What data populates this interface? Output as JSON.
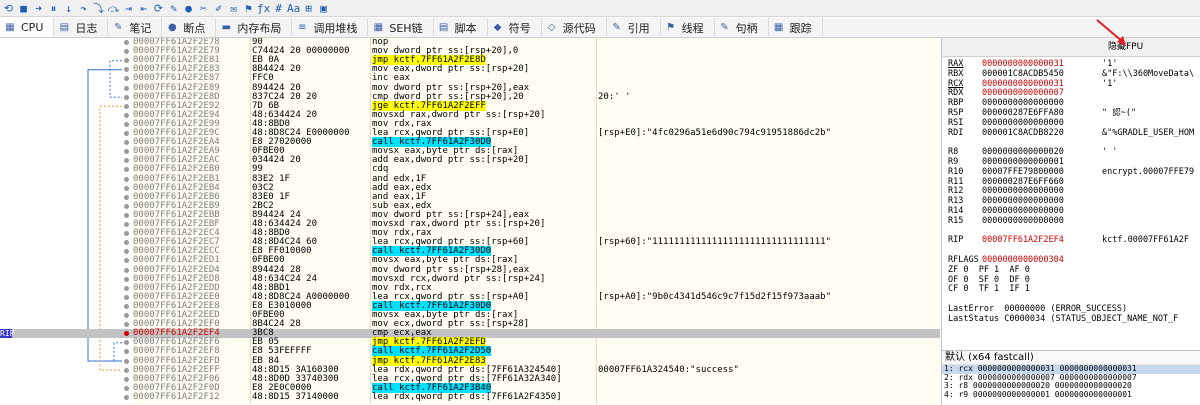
{
  "toolbar": {
    "icons": [
      "restart-icon",
      "stop-icon",
      "run-icon",
      "pause-icon",
      "step-into-icon",
      "step-over-icon",
      "trace-into-icon",
      "trace-over-icon",
      "execute-till-return-icon",
      "run-to-user-code-icon",
      "animate-icon",
      "patch-icon",
      "breakpoint-icon",
      "script-icon",
      "comment-icon",
      "label-icon",
      "bookmark-icon",
      "function-icon",
      "hash-icon",
      "font-icon",
      "calculator-icon",
      "scylla-icon"
    ],
    "glyphs": [
      "⟲",
      "■",
      "➜",
      "⏸",
      "↓",
      "↷",
      "⤵",
      "⤼",
      "⇥",
      "⇤",
      "⟳",
      "✎",
      "●",
      "✂",
      "✐",
      "✉",
      "⚑",
      "ƒx",
      "#",
      "Aa",
      "⊞",
      "▣"
    ]
  },
  "tabs": [
    {
      "label": "CPU",
      "icon": "cpu-icon",
      "glyph": "▦"
    },
    {
      "label": "日志",
      "icon": "log-icon",
      "glyph": "▤"
    },
    {
      "label": "笔记",
      "icon": "notes-icon",
      "glyph": "✎"
    },
    {
      "label": "断点",
      "icon": "breakpoint-icon",
      "glyph": "●"
    },
    {
      "label": "内存布局",
      "icon": "memory-map-icon",
      "glyph": "▬"
    },
    {
      "label": "调用堆栈",
      "icon": "call-stack-icon",
      "glyph": "≡"
    },
    {
      "label": "SEH链",
      "icon": "seh-icon",
      "glyph": "▦"
    },
    {
      "label": "脚本",
      "icon": "script-icon",
      "glyph": "▤"
    },
    {
      "label": "符号",
      "icon": "symbols-icon",
      "glyph": "◆"
    },
    {
      "label": "源代码",
      "icon": "source-icon",
      "glyph": "◇"
    },
    {
      "label": "引用",
      "icon": "references-icon",
      "glyph": "✎"
    },
    {
      "label": "线程",
      "icon": "threads-icon",
      "glyph": "⚑"
    },
    {
      "label": "句柄",
      "icon": "handles-icon",
      "glyph": "✎"
    },
    {
      "label": "跟踪",
      "icon": "trace-icon",
      "glyph": "▦"
    }
  ],
  "disasm": [
    {
      "addr": "00007FF61A2F2E78",
      "bytes": "90",
      "instr": "nop",
      "cmt": ""
    },
    {
      "addr": "00007FF61A2F2E79",
      "bytes": "C74424 20 00000000",
      "instr": "mov dword ptr ss:[rsp+20],0",
      "cmt": ""
    },
    {
      "addr": "00007FF61A2F2E81",
      "bytes": "EB 0A",
      "instr": "jmp kctf.7FF61A2F2E8D",
      "cmt": "",
      "hl": "jmp"
    },
    {
      "addr": "00007FF61A2F2E83",
      "bytes": "8B4424 20",
      "instr": "mov eax,dword ptr ss:[rsp+20]",
      "cmt": ""
    },
    {
      "addr": "00007FF61A2F2E87",
      "bytes": "FFC0",
      "instr": "inc eax",
      "cmt": ""
    },
    {
      "addr": "00007FF61A2F2E89",
      "bytes": "894424 20",
      "instr": "mov dword ptr ss:[rsp+20],eax",
      "cmt": ""
    },
    {
      "addr": "00007FF61A2F2E8D",
      "bytes": "837C24 20 20",
      "instr": "cmp dword ptr ss:[rsp+20],20",
      "cmt": "20:' '"
    },
    {
      "addr": "00007FF61A2F2E92",
      "bytes": "7D 6B",
      "instr": "jge kctf.7FF61A2F2EFF",
      "cmt": "",
      "hl": "jmp"
    },
    {
      "addr": "00007FF61A2F2E94",
      "bytes": "48:634424 20",
      "instr": "movsxd rax,dword ptr ss:[rsp+20]",
      "cmt": ""
    },
    {
      "addr": "00007FF61A2F2E99",
      "bytes": "48:8BD0",
      "instr": "mov rdx,rax",
      "cmt": ""
    },
    {
      "addr": "00007FF61A2F2E9C",
      "bytes": "48:8D8C24 E0000000",
      "instr": "lea rcx,qword ptr ss:[rsp+E0]",
      "cmt": "[rsp+E0]:\"4fc0296a51e6d90c794c91951886dc2b\""
    },
    {
      "addr": "00007FF61A2F2EA4",
      "bytes": "E8 27020000",
      "instr": "call kctf.7FF61A2F30D0",
      "cmt": "",
      "hl": "call"
    },
    {
      "addr": "00007FF61A2F2EA9",
      "bytes": "0FBE00",
      "instr": "movsx eax,byte ptr ds:[rax]",
      "cmt": ""
    },
    {
      "addr": "00007FF61A2F2EAC",
      "bytes": "034424 20",
      "instr": "add eax,dword ptr ss:[rsp+20]",
      "cmt": ""
    },
    {
      "addr": "00007FF61A2F2EB0",
      "bytes": "99",
      "instr": "cdq",
      "cmt": ""
    },
    {
      "addr": "00007FF61A2F2EB1",
      "bytes": "83E2 1F",
      "instr": "and edx,1F",
      "cmt": ""
    },
    {
      "addr": "00007FF61A2F2EB4",
      "bytes": "03C2",
      "instr": "add eax,edx",
      "cmt": ""
    },
    {
      "addr": "00007FF61A2F2EB6",
      "bytes": "83E0 1F",
      "instr": "and eax,1F",
      "cmt": ""
    },
    {
      "addr": "00007FF61A2F2EB9",
      "bytes": "2BC2",
      "instr": "sub eax,edx",
      "cmt": ""
    },
    {
      "addr": "00007FF61A2F2EBB",
      "bytes": "894424 24",
      "instr": "mov dword ptr ss:[rsp+24],eax",
      "cmt": ""
    },
    {
      "addr": "00007FF61A2F2EBF",
      "bytes": "48:634424 20",
      "instr": "movsxd rax,dword ptr ss:[rsp+20]",
      "cmt": ""
    },
    {
      "addr": "00007FF61A2F2EC4",
      "bytes": "48:8BD0",
      "instr": "mov rdx,rax",
      "cmt": ""
    },
    {
      "addr": "00007FF61A2F2EC7",
      "bytes": "48:8D4C24 60",
      "instr": "lea rcx,qword ptr ss:[rsp+60]",
      "cmt": "[rsp+60]:\"11111111111111111111111111111111\""
    },
    {
      "addr": "00007FF61A2F2ECC",
      "bytes": "E8 FF010000",
      "instr": "call kctf.7FF61A2F30D0",
      "cmt": "",
      "hl": "call"
    },
    {
      "addr": "00007FF61A2F2ED1",
      "bytes": "0FBE00",
      "instr": "movsx eax,byte ptr ds:[rax]",
      "cmt": ""
    },
    {
      "addr": "00007FF61A2F2ED4",
      "bytes": "894424 28",
      "instr": "mov dword ptr ss:[rsp+28],eax",
      "cmt": ""
    },
    {
      "addr": "00007FF61A2F2ED8",
      "bytes": "48:634C24 24",
      "instr": "movsxd rcx,dword ptr ss:[rsp+24]",
      "cmt": ""
    },
    {
      "addr": "00007FF61A2F2EDD",
      "bytes": "48:8BD1",
      "instr": "mov rdx,rcx",
      "cmt": ""
    },
    {
      "addr": "00007FF61A2F2EE0",
      "bytes": "48:8D8C24 A0000000",
      "instr": "lea rcx,qword ptr ss:[rsp+A0]",
      "cmt": "[rsp+A0]:\"9b0c4341d546c9c7f15d2f15f973aaab\""
    },
    {
      "addr": "00007FF61A2F2EE8",
      "bytes": "E8 E3010000",
      "instr": "call kctf.7FF61A2F30D0",
      "cmt": "",
      "hl": "call"
    },
    {
      "addr": "00007FF61A2F2EED",
      "bytes": "0FBE00",
      "instr": "movsx eax,byte ptr ds:[rax]",
      "cmt": ""
    },
    {
      "addr": "00007FF61A2F2EF0",
      "bytes": "8B4C24 28",
      "instr": "mov ecx,dword ptr ss:[rsp+28]",
      "cmt": ""
    },
    {
      "addr": "00007FF61A2F2EF4",
      "bytes": "3BC8",
      "instr": "cmp ecx,eax",
      "cmt": "",
      "ip": true
    },
    {
      "addr": "00007FF61A2F2EF6",
      "bytes": "EB 05",
      "instr": "jmp kctf.7FF61A2F2EFD",
      "cmt": "",
      "hl": "jmp"
    },
    {
      "addr": "00007FF61A2F2EF8",
      "bytes": "E8 53FEFFFF",
      "instr": "call kctf.7FF61A2F2D50",
      "cmt": "",
      "hl": "call"
    },
    {
      "addr": "00007FF61A2F2EFD",
      "bytes": "EB 84",
      "instr": "jmp kctf.7FF61A2F2E83",
      "cmt": "",
      "hl": "jmp"
    },
    {
      "addr": "00007FF61A2F2EFF",
      "bytes": "48:8D15 3A160300",
      "instr": "lea rdx,qword ptr ds:[7FF61A324540]",
      "cmt": "00007FF61A324540:\"success\""
    },
    {
      "addr": "00007FF61A2F2F06",
      "bytes": "48:8D0D 33740300",
      "instr": "lea rcx,qword ptr ds:[7FF61A32A340]",
      "cmt": ""
    },
    {
      "addr": "00007FF61A2F2F0D",
      "bytes": "E8 2E0C0000",
      "instr": "call kctf.7FF61A2F3B40",
      "cmt": "",
      "hl": "call"
    },
    {
      "addr": "00007FF61A2F2F12",
      "bytes": "48:8D15 37140000",
      "instr": "lea rdx,qword ptr ds:[7FF61A2F4350]",
      "cmt": ""
    }
  ],
  "ip_label": "RIP",
  "regs": {
    "header": "隐藏FPU",
    "rows": [
      {
        "n": "RAX",
        "v": "0000000000000031",
        "c": "'1'",
        "chg": true,
        "ul": true
      },
      {
        "n": "RBX",
        "v": "000001C8ACDB5450",
        "c": "&\"F:\\\\360MoveData\\"
      },
      {
        "n": "RCX",
        "v": "0000000000000031",
        "c": "'1'",
        "chg": true,
        "ul": true
      },
      {
        "n": "RDX",
        "v": "0000000000000007",
        "c": "",
        "chg": true
      },
      {
        "n": "RBP",
        "v": "0000000000000000",
        "c": ""
      },
      {
        "n": "RSP",
        "v": "000000287E6FFA80",
        "c": "\" 認~(\""
      },
      {
        "n": "RSI",
        "v": "0000000000000000",
        "c": ""
      },
      {
        "n": "RDI",
        "v": "000001C8ACDB8220",
        "c": "&\"%GRADLE_USER_HOM"
      },
      {
        "n": "",
        "v": "",
        "c": ""
      },
      {
        "n": "R8",
        "v": "0000000000000020",
        "c": "' '"
      },
      {
        "n": "R9",
        "v": "0000000000000001",
        "c": ""
      },
      {
        "n": "R10",
        "v": "00007FFE79800000",
        "c": "encrypt.00007FFE79"
      },
      {
        "n": "R11",
        "v": "000000287E6FF660",
        "c": ""
      },
      {
        "n": "R12",
        "v": "0000000000000000",
        "c": ""
      },
      {
        "n": "R13",
        "v": "0000000000000000",
        "c": ""
      },
      {
        "n": "R14",
        "v": "0000000000000000",
        "c": ""
      },
      {
        "n": "R15",
        "v": "0000000000000000",
        "c": ""
      },
      {
        "n": "",
        "v": "",
        "c": ""
      },
      {
        "n": "RIP",
        "v": "00007FF61A2F2EF4",
        "c": "kctf.00007FF61A2F",
        "chg": true
      },
      {
        "n": "",
        "v": "",
        "c": ""
      },
      {
        "n": "RFLAGS",
        "v": "0000000000000304",
        "c": "",
        "chg": true
      }
    ],
    "flags": [
      "ZF 0  PF 1  AF 0",
      "OF 0  SF 0  DF 0",
      "CF 0  TF 1  IF 1"
    ],
    "last_error": "LastError  00000000 (ERROR_SUCCESS)",
    "last_status": "LastStatus C0000034 (STATUS_OBJECT_NAME_NOT_F"
  },
  "stack": {
    "header": "默认 (x64 fastcall)",
    "rows": [
      "1: rcx 0000000000000031 0000000000000031",
      "2: rdx 0000000000000007 0000000000000007",
      "3: r8 0000000000000020 0000000000000020",
      "4: r9 0000000000000001 0000000000000001"
    ]
  },
  "colors": {
    "jmp": "#ffff00",
    "call": "#00e0ff",
    "ip_row": "#c3c3c3",
    "changed": "#d00000"
  }
}
